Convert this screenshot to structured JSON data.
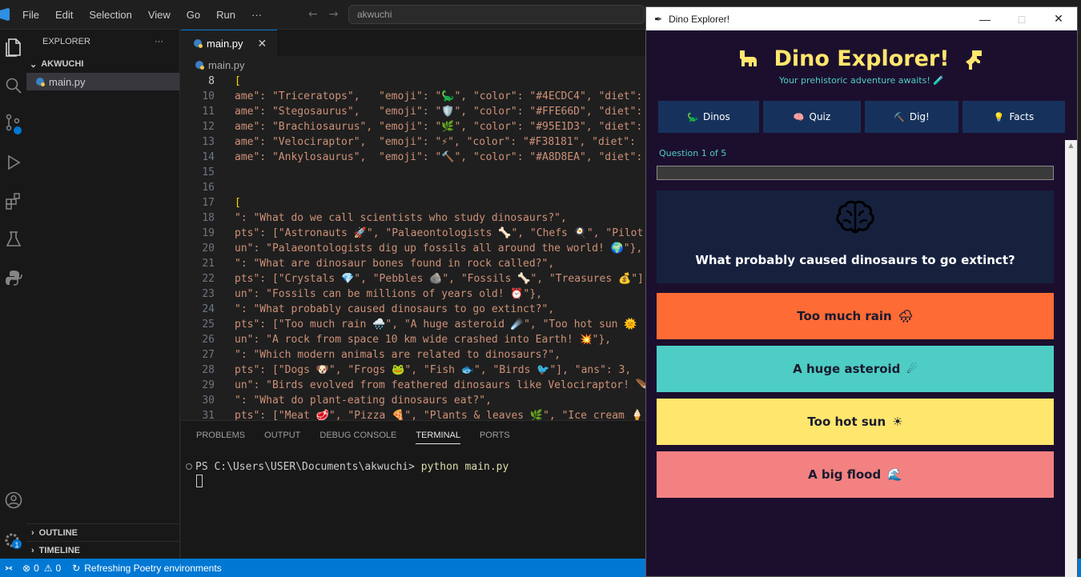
{
  "vscode": {
    "menu": [
      "File",
      "Edit",
      "Selection",
      "View",
      "Go",
      "Run",
      "···"
    ],
    "command_center": "akwuchi",
    "explorer": {
      "title": "EXPLORER",
      "more": "···",
      "folder": "AKWUCHI",
      "file": "main.py",
      "outline": "OUTLINE",
      "timeline": "TIMELINE"
    },
    "tab": {
      "label": "main.py",
      "close": "✕"
    },
    "breadcrumb": "main.py",
    "code_lines": [
      {
        "n": "8",
        "t": "["
      },
      {
        "n": "10",
        "t": "ame\": \"Triceratops\",   \"emoji\": \"🦕\", \"color\": \"#4ECDC4\", \"diet\":"
      },
      {
        "n": "11",
        "t": "ame\": \"Stegosaurus\",   \"emoji\": \"🛡️\", \"color\": \"#FFE66D\", \"diet\":"
      },
      {
        "n": "12",
        "t": "ame\": \"Brachiosaurus\", \"emoji\": \"🌿\", \"color\": \"#95E1D3\", \"diet\":"
      },
      {
        "n": "13",
        "t": "ame\": \"Velociraptor\",  \"emoji\": \"⚡\", \"color\": \"#F38181\", \"diet\":"
      },
      {
        "n": "14",
        "t": "ame\": \"Ankylosaurus\",  \"emoji\": \"🔨\", \"color\": \"#A8D8EA\", \"diet\":"
      },
      {
        "n": "15",
        "t": ""
      },
      {
        "n": "16",
        "t": ""
      },
      {
        "n": "17",
        "t": "["
      },
      {
        "n": "18",
        "t": "\": \"What do we call scientists who study dinosaurs?\","
      },
      {
        "n": "19",
        "t": "pts\": [\"Astronauts 🚀\", \"Palaeontologists 🦴\", \"Chefs 🍳\", \"Pilot"
      },
      {
        "n": "20",
        "t": "un\": \"Palaeontologists dig up fossils all around the world! 🌍\"},"
      },
      {
        "n": "21",
        "t": "\": \"What are dinosaur bones found in rock called?\","
      },
      {
        "n": "22",
        "t": "pts\": [\"Crystals 💎\", \"Pebbles 🪨\", \"Fossils 🦴\", \"Treasures 💰\"]"
      },
      {
        "n": "23",
        "t": "un\": \"Fossils can be millions of years old! ⏰\"},"
      },
      {
        "n": "24",
        "t": "\": \"What probably caused dinosaurs to go extinct?\","
      },
      {
        "n": "25",
        "t": "pts\": [\"Too much rain 🌧️\", \"A huge asteroid ☄️\", \"Too hot sun 🌞"
      },
      {
        "n": "26",
        "t": "un\": \"A rock from space 10 km wide crashed into Earth! 💥\"},"
      },
      {
        "n": "27",
        "t": "\": \"Which modern animals are related to dinosaurs?\","
      },
      {
        "n": "28",
        "t": "pts\": [\"Dogs 🐶\", \"Frogs 🐸\", \"Fish 🐟\", \"Birds 🐦\"], \"ans\": 3,"
      },
      {
        "n": "29",
        "t": "un\": \"Birds evolved from feathered dinosaurs like Velociraptor! 🪶"
      },
      {
        "n": "30",
        "t": "\": \"What do plant-eating dinosaurs eat?\","
      },
      {
        "n": "31",
        "t": "pts\": [\"Meat 🥩\", \"Pizza 🍕\", \"Plants & leaves 🌿\", \"Ice cream 🍦"
      }
    ],
    "panel_tabs": [
      "PROBLEMS",
      "OUTPUT",
      "DEBUG CONSOLE",
      "TERMINAL",
      "PORTS"
    ],
    "terminal": {
      "prompt": "PS C:\\Users\\USER\\Documents\\akwuchi>",
      "command": "python main.py"
    },
    "status": {
      "errors": "0",
      "warnings": "0",
      "message": "Refreshing Poetry environments"
    },
    "badge": "1"
  },
  "dino_app": {
    "window_title": "Dino Explorer!",
    "heading": "Dino Explorer!",
    "subtitle": "Your prehistoric adventure awaits! 🧪",
    "nav": [
      {
        "icon": "🦕",
        "label": "Dinos"
      },
      {
        "icon": "🧠",
        "label": "Quiz"
      },
      {
        "icon": "⛏️",
        "label": "Dig!"
      },
      {
        "icon": "💡",
        "label": "Facts"
      }
    ],
    "progress_label": "Question 1 of 5",
    "progress_fraction": 0.0,
    "question": "What probably caused dinosaurs to go extinct?",
    "answers": [
      {
        "label": "Too much rain",
        "icon": "🌧",
        "color": "#FF6B35"
      },
      {
        "label": "A huge asteroid",
        "icon": "☄",
        "color": "#4ECDC4"
      },
      {
        "label": "Too hot sun",
        "icon": "☀",
        "color": "#FFE66D"
      },
      {
        "label": "A big flood",
        "icon": "🌊",
        "color": "#F38181"
      }
    ],
    "colors": {
      "bg": "#1c0f2e",
      "nav": "#16325c",
      "card": "#16213e",
      "accent_yellow": "#ffe66d",
      "accent_teal": "#4ecdc4"
    }
  }
}
